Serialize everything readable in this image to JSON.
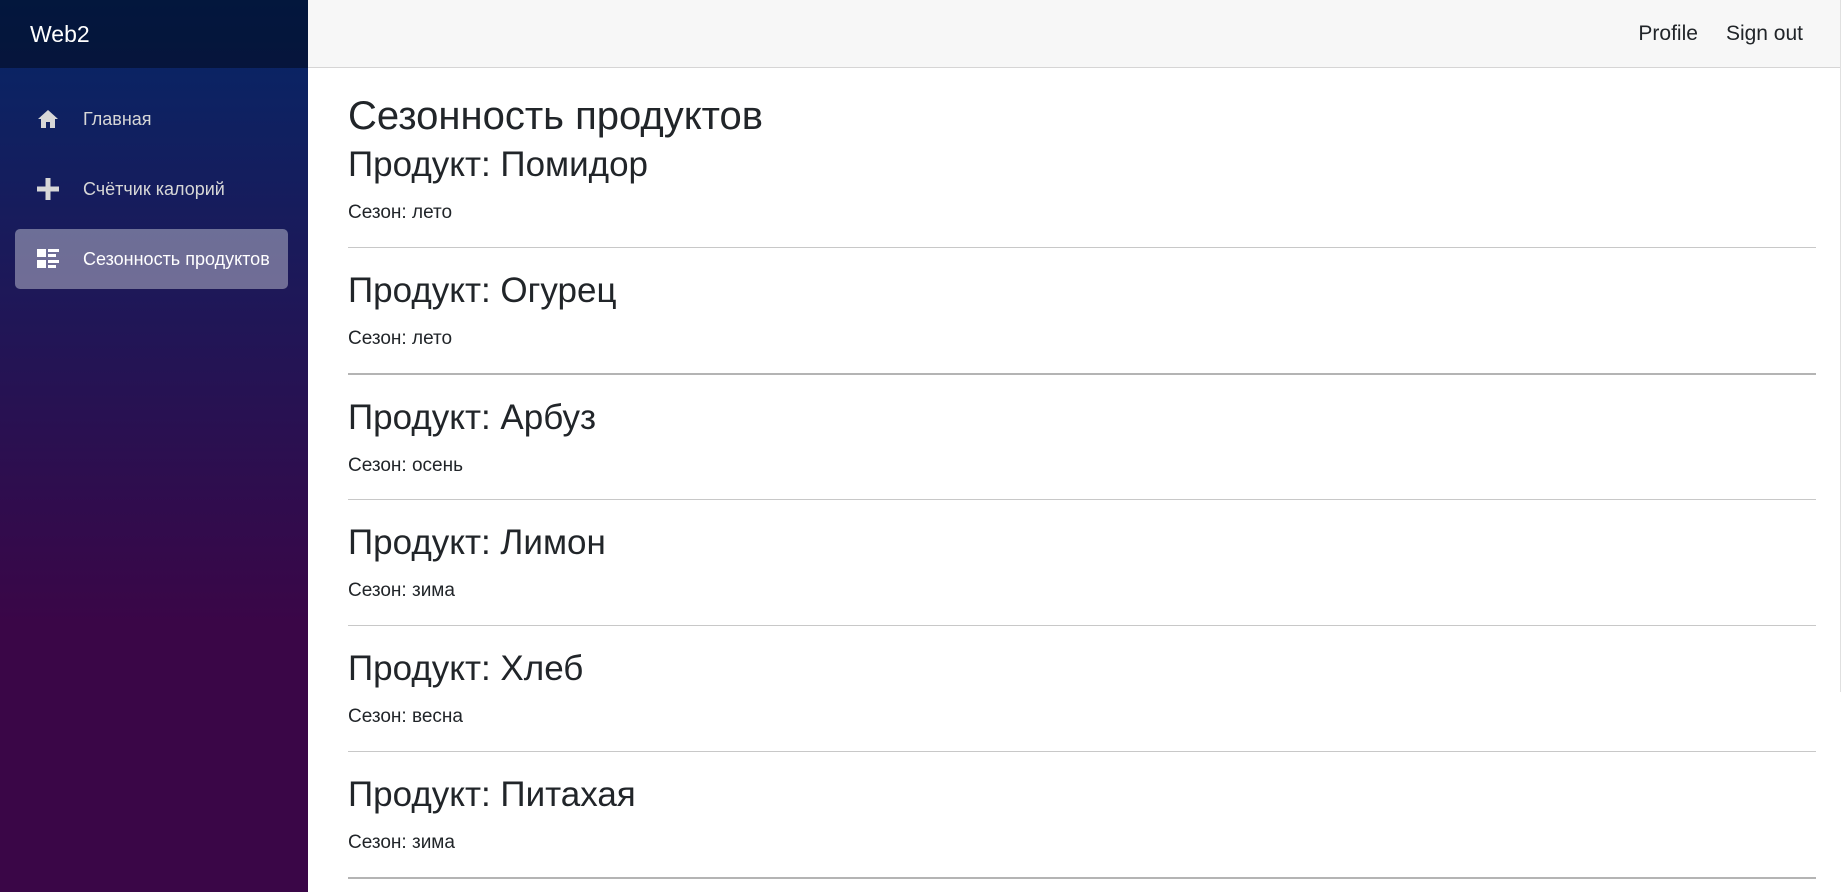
{
  "sidebar": {
    "brand": "Web2",
    "items": [
      {
        "label": "Главная",
        "icon": "home-icon",
        "active": false
      },
      {
        "label": "Счётчик калорий",
        "icon": "plus-icon",
        "active": false
      },
      {
        "label": "Сезонность продуктов",
        "icon": "list-rich-icon",
        "active": true
      }
    ]
  },
  "header": {
    "profile_label": "Profile",
    "signout_label": "Sign out"
  },
  "main": {
    "title": "Сезонность продуктов",
    "products": [
      {
        "name": "Продукт: Помидор",
        "season": "Сезон: лето"
      },
      {
        "name": "Продукт: Огурец",
        "season": "Сезон: лето"
      },
      {
        "name": "Продукт: Арбуз",
        "season": "Сезон: осень"
      },
      {
        "name": "Продукт: Лимон",
        "season": "Сезон: зима"
      },
      {
        "name": "Продукт: Хлеб",
        "season": "Сезон: весна"
      },
      {
        "name": "Продукт: Питахая",
        "season": "Сезон: зима"
      }
    ]
  },
  "colors": {
    "sidebar_top": "#052767",
    "sidebar_bottom": "#3a0647",
    "active_item_bg": "#6b6b9a"
  }
}
